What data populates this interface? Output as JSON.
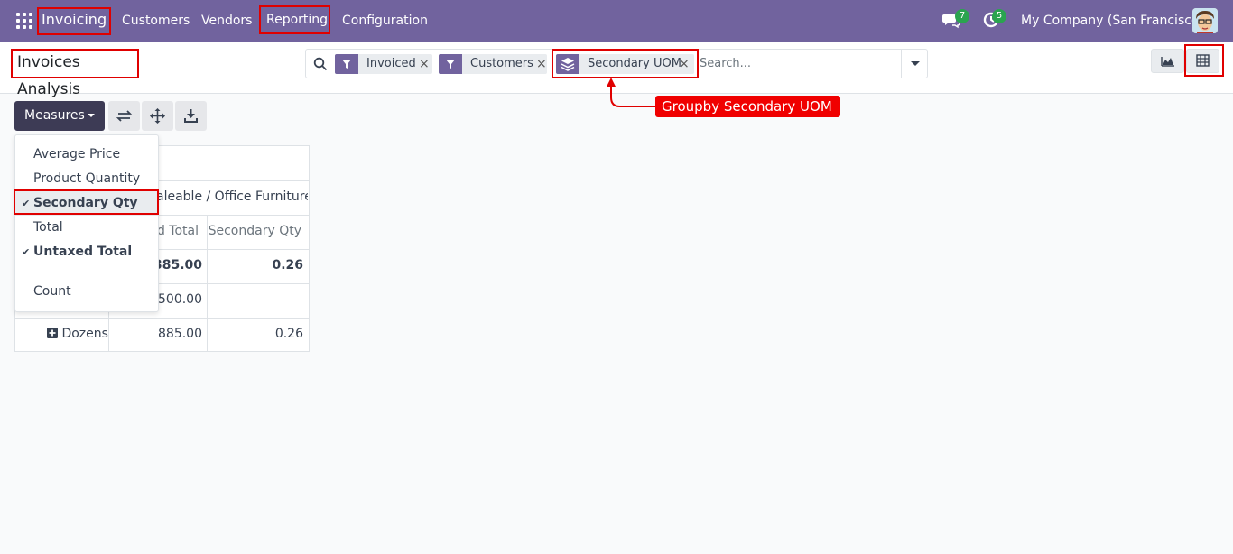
{
  "navbar": {
    "app_name": "Invoicing",
    "menus": [
      "Customers",
      "Vendors",
      "Reporting",
      "Configuration"
    ],
    "messages_count": "7",
    "activities_count": "5",
    "company": "My Company (San Francisco)"
  },
  "control": {
    "title": "Invoices Analysis",
    "facets": [
      "Invoiced",
      "Customers",
      "Secondary UOM"
    ],
    "search_placeholder": "Search..."
  },
  "toolbar": {
    "measures_label": "Measures"
  },
  "measures_menu": {
    "items": [
      {
        "label": "Average Price",
        "checked": false
      },
      {
        "label": "Product Quantity",
        "checked": false
      },
      {
        "label": "Secondary Qty",
        "checked": true
      },
      {
        "label": "Total",
        "checked": false
      },
      {
        "label": "Untaxed Total",
        "checked": true
      }
    ],
    "count_label": "Count"
  },
  "pivot": {
    "col_group": "aleable / Office Furniture",
    "measure_headers": [
      "d Total",
      "Secondary Qty"
    ],
    "rows": [
      {
        "label": "",
        "untaxed": ",385.00",
        "secondary": "0.26"
      },
      {
        "label": "",
        "untaxed": ",500.00",
        "secondary": ""
      },
      {
        "label": "Dozens",
        "untaxed": "885.00",
        "secondary": "0.26"
      }
    ]
  },
  "annotation": {
    "text": "Groupby Secondary UOM"
  },
  "colors": {
    "navbar": "#71639e",
    "measures_button": "#3d3b55",
    "highlight": "#e00000",
    "badge": "#2aa44f"
  }
}
